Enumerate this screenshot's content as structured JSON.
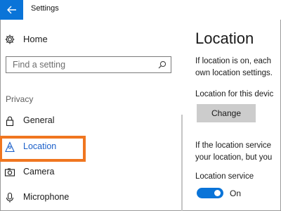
{
  "window": {
    "title": "Settings"
  },
  "sidebar": {
    "home_label": "Home",
    "search_placeholder": "Find a setting",
    "section_label": "Privacy",
    "items": [
      {
        "label": "General",
        "icon": "lock-icon"
      },
      {
        "label": "Location",
        "icon": "location-icon",
        "selected": true
      },
      {
        "label": "Camera",
        "icon": "camera-icon"
      },
      {
        "label": "Microphone",
        "icon": "microphone-icon"
      }
    ]
  },
  "main": {
    "title": "Location",
    "intro_lines": [
      "If location is on, each",
      "own location settings."
    ],
    "device_label": "Location for this devic",
    "change_button": "Change",
    "service_desc_lines": [
      "If the location service",
      "your location, but you"
    ],
    "service_label": "Location service",
    "toggle_state": "On"
  },
  "colors": {
    "accent": "#0a74d8",
    "highlight": "#f07620",
    "button_bg": "#cccccc"
  }
}
